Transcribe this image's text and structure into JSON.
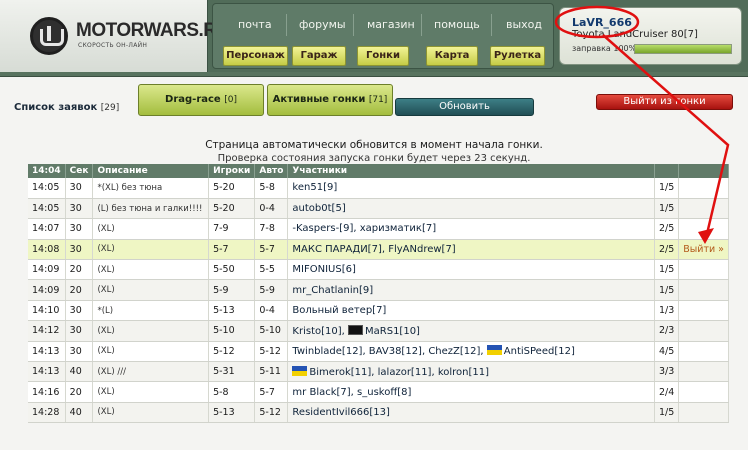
{
  "header": {
    "logo": {
      "title": "MOTORWARS.RU",
      "subtitle": "СКОРОСТЬ ОН-ЛАЙН"
    },
    "top_links": [
      "почта",
      "форумы",
      "магазин",
      "помощь",
      "выход"
    ],
    "nav_buttons": [
      "Персонаж",
      "Гараж",
      "Гонки",
      "Карта",
      "Рулетка"
    ],
    "user": {
      "name": "LaVR_666",
      "car": "Toyota LandCruiser 80[7]",
      "fuel_label": "заправка 100%",
      "fuel_percent": 100
    }
  },
  "toolbar": {
    "list_title": "Список заявок",
    "list_count": "[29]",
    "tabs": [
      {
        "label": "Drag-race",
        "count": "[0]"
      },
      {
        "label": "Активные гонки",
        "count": "[71]"
      }
    ],
    "refresh": "Обновить",
    "exit_race": "Выйти из гонки"
  },
  "notice": {
    "line1": "Страница автоматически обновится в момент начала гонки.",
    "line2": "Проверка состояния запуска гонки будет через 23 секунд."
  },
  "table": {
    "headers": [
      "14:04",
      "Сек",
      "Описание",
      "Игроки",
      "Авто",
      "Участники",
      "",
      ""
    ],
    "rows": [
      {
        "time": "14:05",
        "sec": "30",
        "desc": "*(XL) без тюна",
        "players": "5-20",
        "auto": "5-8",
        "participants": "ken51[9]",
        "count": "1/5",
        "action": ""
      },
      {
        "time": "14:05",
        "sec": "30",
        "desc": "(L) без тюна и галки!!!!",
        "players": "5-20",
        "auto": "0-4",
        "participants": "autob0t[5]",
        "count": "1/5",
        "action": ""
      },
      {
        "time": "14:07",
        "sec": "30",
        "desc": "(XL)",
        "players": "7-9",
        "auto": "7-8",
        "participants": "-Kaspers-[9], харизматик[7]",
        "count": "2/5",
        "action": ""
      },
      {
        "time": "14:08",
        "sec": "30",
        "desc": "(XL)",
        "players": "5-7",
        "auto": "5-7",
        "participants": "МАКС ПАРАДИ[7], FlyANdrew[7]",
        "count": "2/5",
        "action": "Выйти »"
      },
      {
        "time": "14:09",
        "sec": "20",
        "desc": "(XL)",
        "players": "5-50",
        "auto": "5-5",
        "participants": "MIFONIUS[6]",
        "count": "1/5",
        "action": ""
      },
      {
        "time": "14:09",
        "sec": "20",
        "desc": "(XL)",
        "players": "5-9",
        "auto": "5-9",
        "participants": "mr_Chatlanin[9]",
        "count": "1/5",
        "action": ""
      },
      {
        "time": "14:10",
        "sec": "30",
        "desc": "*(L)",
        "players": "5-13",
        "auto": "0-4",
        "participants": "Вольный ветер[7]",
        "count": "1/3",
        "action": ""
      },
      {
        "time": "14:12",
        "sec": "30",
        "desc": "(XL)",
        "players": "5-10",
        "auto": "5-10",
        "participants_parts": [
          "Kristo[10], ",
          "MaRS1[10]"
        ],
        "count": "2/3",
        "action": ""
      },
      {
        "time": "14:13",
        "sec": "30",
        "desc": "(XL)",
        "players": "5-12",
        "auto": "5-12",
        "participants_parts": [
          "Twinblade[12], BAV38[12], ChezZ[12], ",
          "AntiSPeed[12]"
        ],
        "count": "4/5",
        "action": ""
      },
      {
        "time": "14:13",
        "sec": "40",
        "desc": "(XL) ///",
        "players": "5-31",
        "auto": "5-11",
        "participants_parts": [
          "Bimerok[11], lalazor[11], kolron[11]"
        ],
        "count": "3/3",
        "action": ""
      },
      {
        "time": "14:16",
        "sec": "20",
        "desc": "(XL)",
        "players": "5-8",
        "auto": "5-7",
        "participants": "mr Black[7], s_uskoff[8]",
        "count": "2/4",
        "action": ""
      },
      {
        "time": "14:28",
        "sec": "40",
        "desc": "(XL)",
        "players": "5-13",
        "auto": "5-12",
        "participants": "ResidentIvil666[13]",
        "count": "1/5",
        "action": ""
      }
    ]
  },
  "colors": {
    "header_bg": "#516c59",
    "nav_btn": "#e3e57c",
    "tab_btn": "#c2d56a",
    "refresh_btn": "#2b6168",
    "exit_btn": "#c91f17",
    "highlight_row": "#eff6c4",
    "annotation": "#e01010"
  }
}
